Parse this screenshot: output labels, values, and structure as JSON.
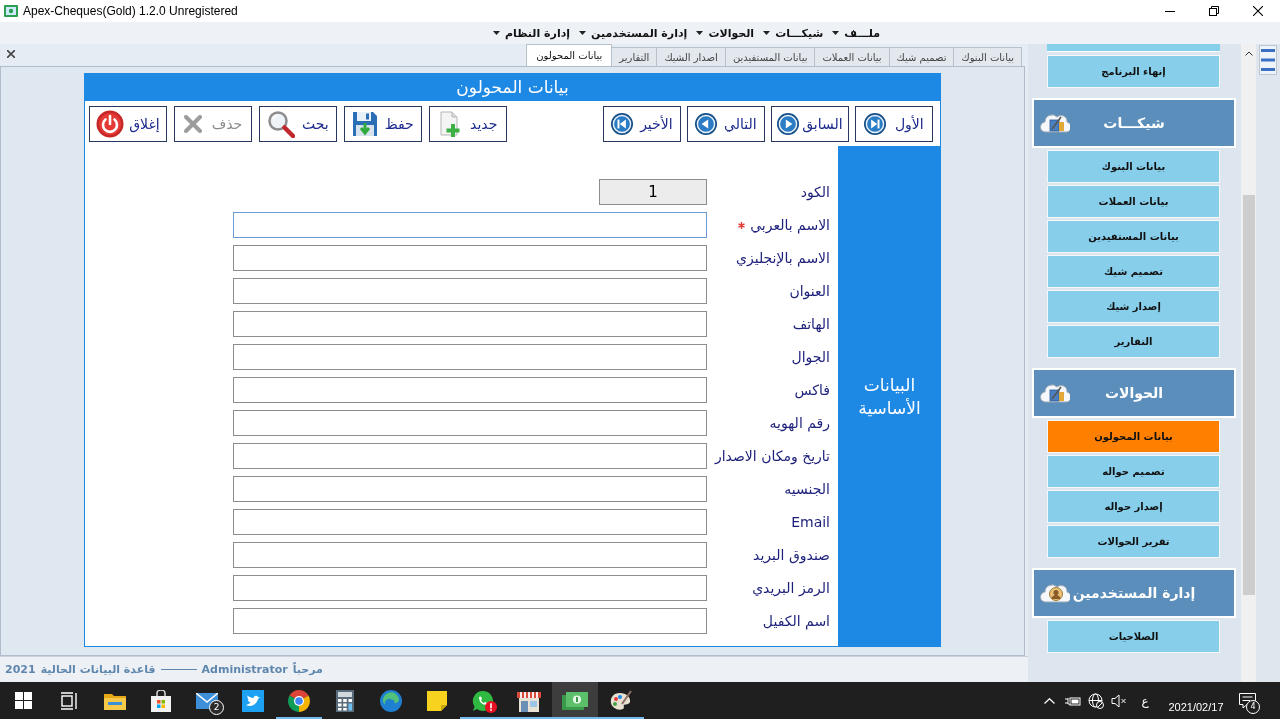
{
  "window": {
    "title": "Apex-Cheques(Gold) 1.2.0 Unregistered"
  },
  "menu": [
    "ملـــف",
    "شيكـــات",
    "الحوالات",
    "إدارة المستخدمين",
    "إدارة النظام"
  ],
  "tabs": [
    {
      "label": "بيانات البنوك",
      "selected": false
    },
    {
      "label": "تصميم شيك",
      "selected": false
    },
    {
      "label": "بيانات العملات",
      "selected": false
    },
    {
      "label": "بيانات المستفيدين",
      "selected": false
    },
    {
      "label": "اصدار الشيك",
      "selected": false
    },
    {
      "label": "التقارير",
      "selected": false
    },
    {
      "label": "بيانات المحولون",
      "selected": true
    }
  ],
  "form": {
    "title": "بيانات المحولون",
    "nav_buttons": [
      {
        "kind": "first",
        "label": "الأول"
      },
      {
        "kind": "previous",
        "label": "السابق"
      },
      {
        "kind": "next",
        "label": "التالي"
      },
      {
        "kind": "last",
        "label": "الأخير"
      }
    ],
    "action_buttons": [
      {
        "kind": "new",
        "label": "جديد",
        "disabled": false
      },
      {
        "kind": "save",
        "label": "حفظ",
        "disabled": false
      },
      {
        "kind": "search",
        "label": "بحث",
        "disabled": false
      },
      {
        "kind": "delete",
        "label": "حذف",
        "disabled": true
      },
      {
        "kind": "close",
        "label": "إغلاق",
        "disabled": false
      }
    ],
    "section_label": "البيانات الأساسية",
    "fields": [
      {
        "label": "الكود",
        "value": "1",
        "readonly": true,
        "required": false,
        "focused": false
      },
      {
        "label": "الاسم بالعربي",
        "readonly": false,
        "required": true,
        "focused": true
      },
      {
        "label": "الاسم بالإنجليزي",
        "readonly": false,
        "required": false,
        "focused": false
      },
      {
        "label": "العنوان",
        "readonly": false,
        "required": false,
        "focused": false
      },
      {
        "label": "الهاتف",
        "readonly": false,
        "required": false,
        "focused": false
      },
      {
        "label": "الجوال",
        "readonly": false,
        "required": false,
        "focused": false
      },
      {
        "label": "فاكس",
        "readonly": false,
        "required": false,
        "focused": false
      },
      {
        "label": "رقم الهويه",
        "readonly": false,
        "required": false,
        "focused": false
      },
      {
        "label": "تاريخ ومكان الاصدار",
        "readonly": false,
        "required": false,
        "focused": false
      },
      {
        "label": "الجنسيه",
        "readonly": false,
        "required": false,
        "focused": false
      },
      {
        "label": "Email",
        "readonly": false,
        "required": false,
        "focused": false
      },
      {
        "label": "صندوق البريد",
        "readonly": false,
        "required": false,
        "focused": false
      },
      {
        "label": "الرمز البريدي",
        "readonly": false,
        "required": false,
        "focused": false
      },
      {
        "label": "اسم الكفيل",
        "readonly": false,
        "required": false,
        "focused": false
      }
    ]
  },
  "sidebar": {
    "top_items": [
      {
        "label": "إنهاء البرنامج",
        "selected": false
      }
    ],
    "groups": [
      {
        "kind": "document",
        "title": "شيكـــات",
        "items": [
          {
            "label": "بيانات البنوك",
            "selected": false
          },
          {
            "label": "بيانات العملات",
            "selected": false
          },
          {
            "label": "بيانات المستفيدين",
            "selected": false
          },
          {
            "label": "تصميم شيك",
            "selected": false
          },
          {
            "label": "إصدار شيك",
            "selected": false
          },
          {
            "label": "التقارير",
            "selected": false
          }
        ]
      },
      {
        "kind": "document",
        "title": "الحوالات",
        "items": [
          {
            "label": "بيانات المحولون",
            "selected": true
          },
          {
            "label": "تصميم حواله",
            "selected": false
          },
          {
            "label": "إصدار حواله",
            "selected": false
          },
          {
            "label": "تقرير الحوالات",
            "selected": false
          }
        ]
      },
      {
        "kind": "users",
        "title": "إدارة المستخدمين",
        "items": [
          {
            "label": "الصلاحيات",
            "selected": false
          }
        ]
      }
    ]
  },
  "status_bar": {
    "greeting": "مرحباً",
    "user": "Administrator",
    "database_label": "قاعدة البيانات الحالية",
    "database": "2021"
  },
  "taskbar": {
    "apps": [
      {
        "kind": "start",
        "running": false,
        "active": false,
        "alert": false
      },
      {
        "kind": "task_view",
        "running": false,
        "active": false,
        "alert": false
      },
      {
        "kind": "explorer",
        "running": false,
        "active": false,
        "alert": false
      },
      {
        "kind": "store",
        "running": false,
        "active": false,
        "alert": false
      },
      {
        "kind": "mail",
        "running": false,
        "active": false,
        "alert": false,
        "badge": "2"
      },
      {
        "kind": "twitter",
        "running": false,
        "active": false,
        "alert": false
      },
      {
        "kind": "chrome",
        "running": true,
        "active": false,
        "alert": false
      },
      {
        "kind": "calculator",
        "running": false,
        "active": false,
        "alert": false
      },
      {
        "kind": "edge",
        "running": false,
        "active": false,
        "alert": false
      },
      {
        "kind": "notes",
        "running": false,
        "active": false,
        "alert": false
      },
      {
        "kind": "whatsapp",
        "running": true,
        "active": false,
        "alert": true
      },
      {
        "kind": "shop",
        "running": true,
        "active": false,
        "alert": false
      },
      {
        "kind": "cheques",
        "running": true,
        "active": true,
        "alert": false
      },
      {
        "kind": "paint",
        "running": true,
        "active": false,
        "alert": false
      }
    ],
    "tray": {
      "language": "ع",
      "date": "2021/02/17",
      "notifications": "4"
    }
  }
}
